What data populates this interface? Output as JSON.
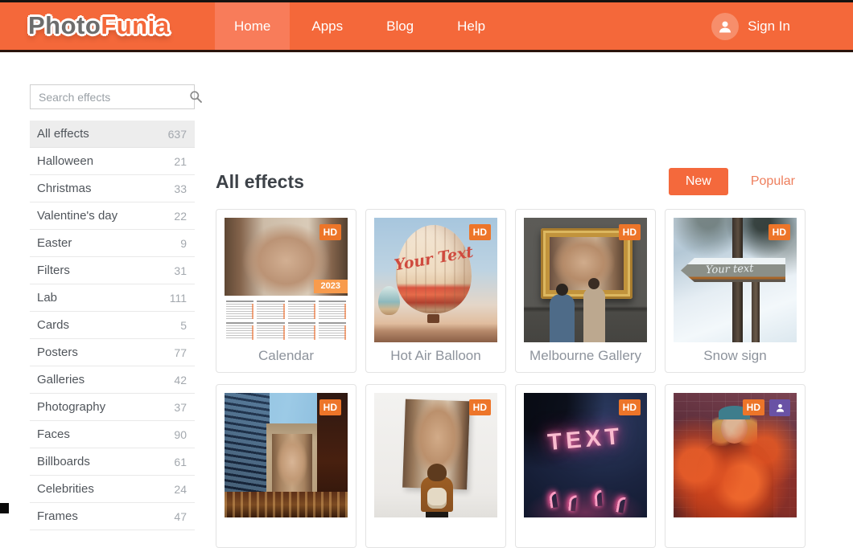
{
  "brand": {
    "orange": "#f4683a",
    "active_tab": "#f87c5a",
    "hd_badge": "#ed7529",
    "person_badge": "#6952a5",
    "year_badge": "#f89b4c"
  },
  "header": {
    "logo_part1": "Photo",
    "logo_part2": "Funia",
    "nav": [
      {
        "label": "Home",
        "active": true
      },
      {
        "label": "Apps",
        "active": false
      },
      {
        "label": "Blog",
        "active": false
      },
      {
        "label": "Help",
        "active": false
      }
    ],
    "sign_in_label": "Sign In"
  },
  "sidebar": {
    "search_placeholder": "Search effects",
    "categories": [
      {
        "label": "All effects",
        "count": "637",
        "active": true
      },
      {
        "label": "Halloween",
        "count": "21",
        "active": false
      },
      {
        "label": "Christmas",
        "count": "33",
        "active": false
      },
      {
        "label": "Valentine's day",
        "count": "22",
        "active": false
      },
      {
        "label": "Easter",
        "count": "9",
        "active": false
      },
      {
        "label": "Filters",
        "count": "31",
        "active": false
      },
      {
        "label": "Lab",
        "count": "111",
        "active": false
      },
      {
        "label": "Cards",
        "count": "5",
        "active": false
      },
      {
        "label": "Posters",
        "count": "77",
        "active": false
      },
      {
        "label": "Galleries",
        "count": "42",
        "active": false
      },
      {
        "label": "Photography",
        "count": "37",
        "active": false
      },
      {
        "label": "Faces",
        "count": "90",
        "active": false
      },
      {
        "label": "Billboards",
        "count": "61",
        "active": false
      },
      {
        "label": "Celebrities",
        "count": "24",
        "active": false
      },
      {
        "label": "Frames",
        "count": "47",
        "active": false
      }
    ]
  },
  "main": {
    "title": "All effects",
    "filters": {
      "new": "New",
      "popular": "Popular"
    },
    "badge_hd": "HD",
    "cards": [
      {
        "title": "Calendar",
        "art": "calendar",
        "badges": [
          "HD"
        ],
        "year_tag": "2023"
      },
      {
        "title": "Hot Air Balloon",
        "art": "balloon",
        "badges": [
          "HD"
        ],
        "overlay_text": "Your Text"
      },
      {
        "title": "Melbourne Gallery",
        "art": "gallery",
        "badges": [
          "HD"
        ]
      },
      {
        "title": "Snow sign",
        "art": "snow",
        "badges": [
          "HD"
        ],
        "overlay_text": "Your text"
      },
      {
        "title": "",
        "art": "city-billboard",
        "badges": [
          "HD"
        ]
      },
      {
        "title": "",
        "art": "white-gallery",
        "badges": [
          "HD"
        ]
      },
      {
        "title": "",
        "art": "neon-lights",
        "badges": [
          "HD"
        ],
        "overlay_text": "TEXT"
      },
      {
        "title": "",
        "art": "orange-smoke",
        "badges": [
          "HD",
          "person"
        ]
      }
    ]
  }
}
